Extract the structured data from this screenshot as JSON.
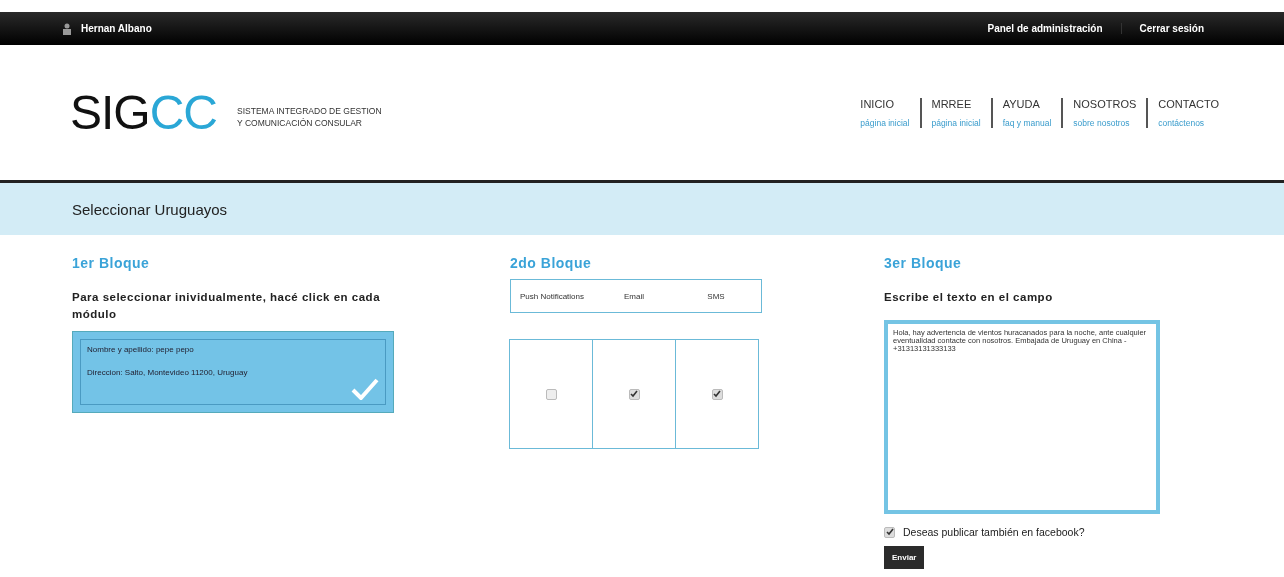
{
  "top_bar": {
    "user_name": "Hernan Albano",
    "links": [
      "Panel de administración",
      "Cerrar sesión"
    ]
  },
  "logo": {
    "dark_part": "SIG",
    "accent_part": "CC",
    "tagline": [
      "SISTEMA INTEGRADO DE GESTION",
      "Y COMUNICACIÓN CONSULAR"
    ]
  },
  "nav": [
    {
      "title": "INICIO",
      "subtitle": "página inicial"
    },
    {
      "title": "MRREE",
      "subtitle": "página inicial"
    },
    {
      "title": "AYUDA",
      "subtitle": "faq y manual"
    },
    {
      "title": "NOSOTROS",
      "subtitle": "sobre nosotros"
    },
    {
      "title": "CONTACTO",
      "subtitle": "contáctenos"
    }
  ],
  "page_title": "Seleccionar Uruguayos",
  "block_1": {
    "heading": "1er Bloque",
    "instruction": "Para seleccionar inividualmente, hacé click en cada módulo",
    "cards": [
      {
        "name_line": "Nombre y apellido: pepe pepo",
        "address_line": "Direccion: Salto, Montevideo 11200, Uruguay",
        "selected": true
      }
    ]
  },
  "block_2": {
    "heading": "2do Bloque",
    "channels": [
      {
        "label": "Push Notifications",
        "checked": false
      },
      {
        "label": "Email",
        "checked": true
      },
      {
        "label": "SMS",
        "checked": true
      }
    ]
  },
  "block_3": {
    "heading": "3er Bloque",
    "prompt": "Escribe el texto en el campo",
    "message": "Hola, hay advertencia de vientos huracanados para la noche, ante cualquier eventualidad contacte con nosotros. Embajada de Uruguay en China - +31313131333133",
    "facebook": {
      "label": "Deseas publicar también en facebook?",
      "checked": true
    },
    "submit": "Enviar"
  }
}
